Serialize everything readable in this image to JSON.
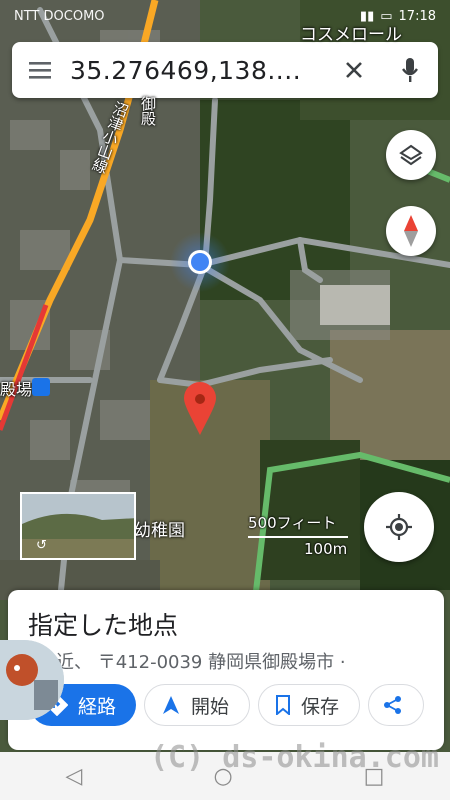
{
  "status_bar": {
    "carrier": "NTT DOCOMO",
    "time": "17:18"
  },
  "search": {
    "query": "35.276469,138....",
    "menu_icon": "menu-icon",
    "clear_icon": "close-icon",
    "mic_icon": "mic-icon"
  },
  "map_labels": {
    "top_right_place": "コスメロール",
    "road_name": "沼津小山線",
    "road_name_2": "御殿",
    "station": "殿場",
    "kindergarten": "幼稚園"
  },
  "scale": {
    "imperial": "500フィート",
    "metric": "100m"
  },
  "place_sheet": {
    "title": "指定した地点",
    "address": "付近、 〒412-0039 静岡県御殿場市 ·"
  },
  "actions": [
    {
      "label": "経路",
      "icon": "directions-icon"
    },
    {
      "label": "開始",
      "icon": "navigation-arrow-icon"
    },
    {
      "label": "保存",
      "icon": "bookmark-icon"
    },
    {
      "label": "",
      "icon": "share-icon"
    }
  ],
  "watermark": "(C) ds-okina.com",
  "colors": {
    "accent": "#1a73e8",
    "pin": "#ea4335",
    "location_dot": "#4285f4",
    "highway": "#f9a825"
  }
}
